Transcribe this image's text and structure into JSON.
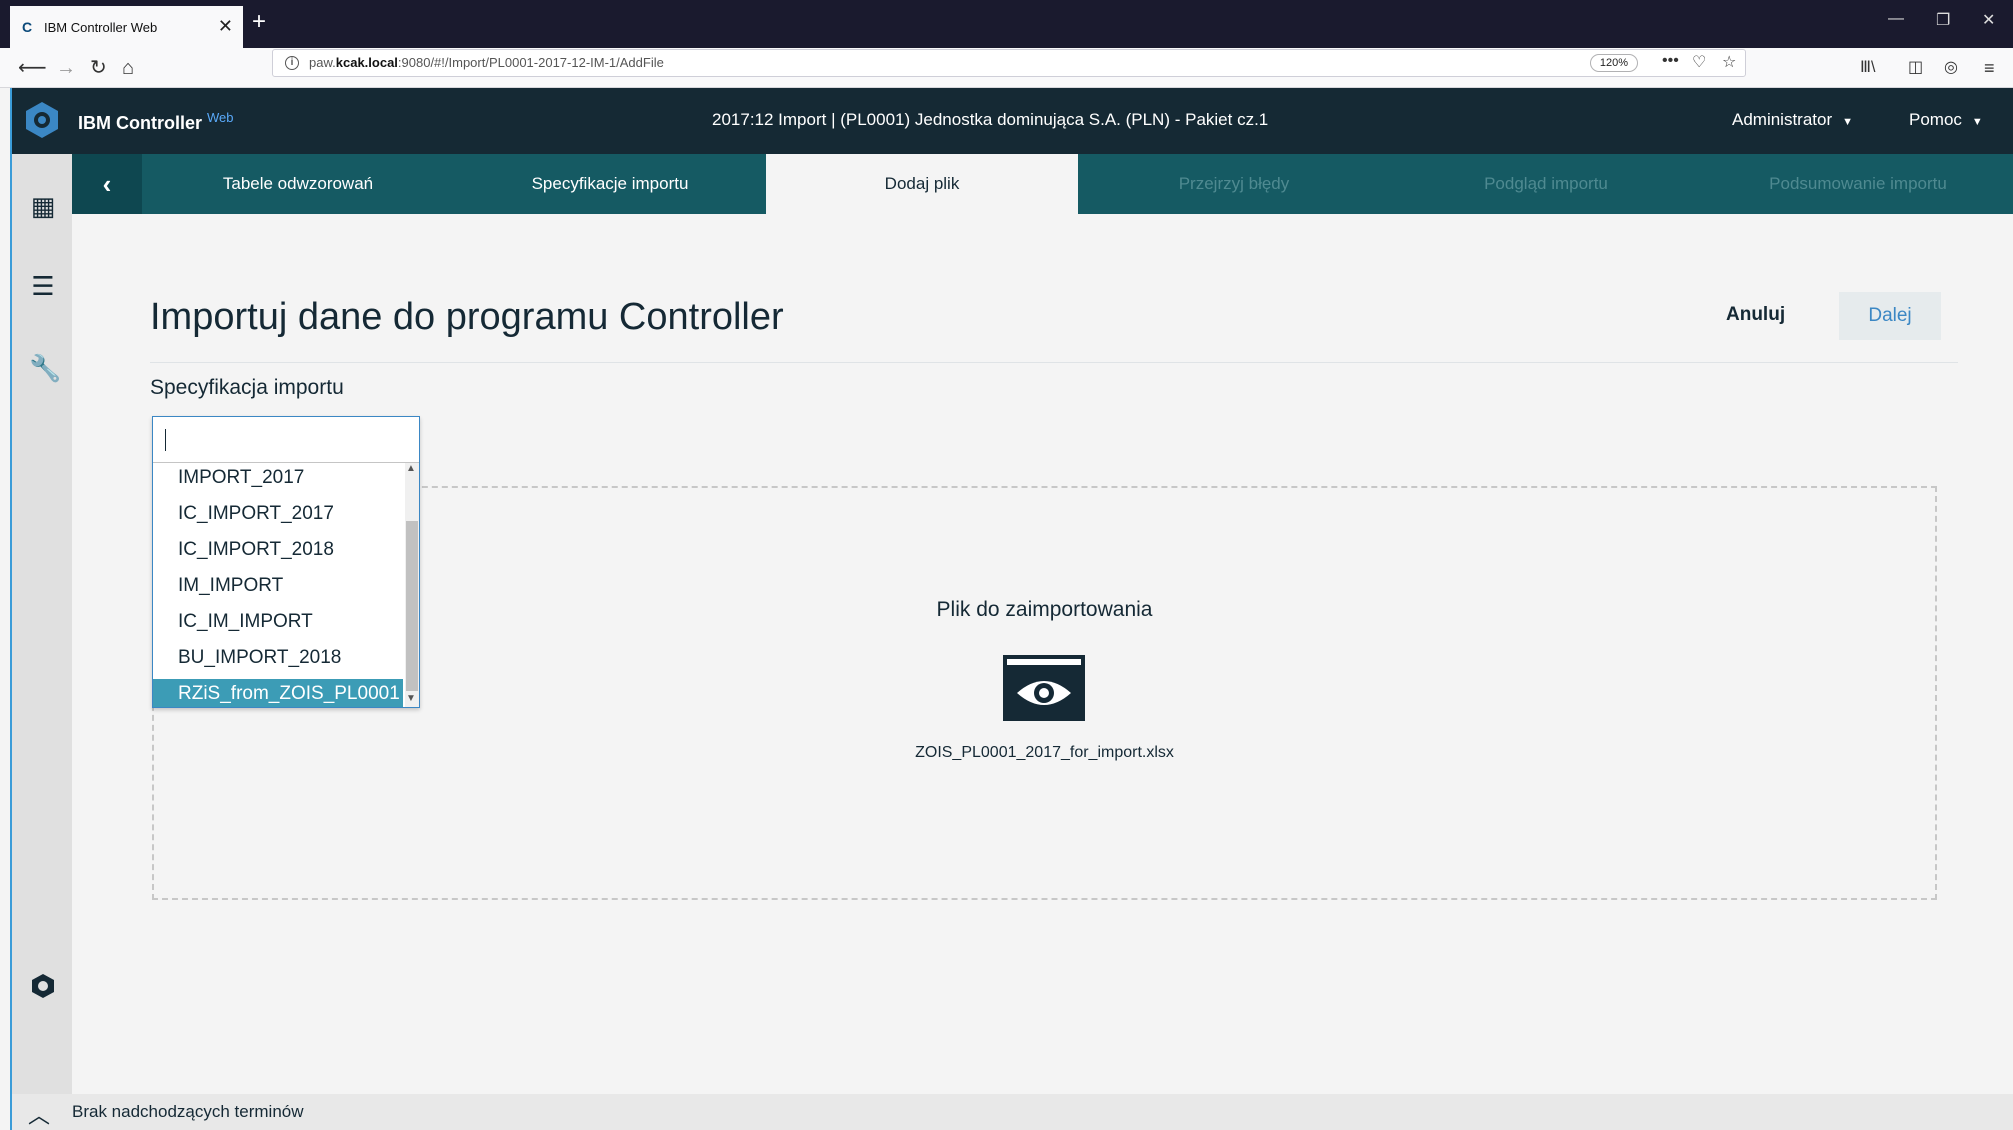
{
  "browser": {
    "tab_title": "IBM Controller Web",
    "url_host_prefix": "paw.",
    "url_host_bold": "kcak.local",
    "url_rest": ":9080/#!/Import/PL0001-2017-12-IM-1/AddFile",
    "zoom": "120%"
  },
  "header": {
    "brand": "IBM Controller",
    "brand_sup": "Web",
    "context": "2017:12 Import  |  (PL0001) Jednostka dominująca S.A. (PLN) - Pakiet cz.1",
    "user": "Administrator",
    "help": "Pomoc"
  },
  "wizard": {
    "steps": [
      {
        "label": "Tabele odwzorowań",
        "state": "done"
      },
      {
        "label": "Specyfikacje importu",
        "state": "done"
      },
      {
        "label": "Dodaj plik",
        "state": "active"
      },
      {
        "label": "Przejrzyj błędy",
        "state": "disabled"
      },
      {
        "label": "Podgląd importu",
        "state": "disabled"
      },
      {
        "label": "Podsumowanie importu",
        "state": "disabled"
      }
    ]
  },
  "page": {
    "title": "Importuj dane do programu Controller",
    "cancel": "Anuluj",
    "next": "Dalej",
    "spec_label": "Specyfikacja importu"
  },
  "dropdown": {
    "input_value": "",
    "options": [
      "IMPORT_2017",
      "IC_IMPORT_2017",
      "IC_IMPORT_2018",
      "IM_IMPORT",
      "IC_IM_IMPORT",
      "BU_IMPORT_2018",
      "RZiS_from_ZOIS_PL0001"
    ],
    "selected_index": 6
  },
  "dropzone": {
    "title": "Plik do zaimportowania",
    "file_name": "ZOIS_PL0001_2017_for_import.xlsx",
    "file_icon": "eye-icon"
  },
  "footer": {
    "text": "Brak nadchodzących terminów"
  },
  "colors": {
    "header_bg": "#152934",
    "wizard_bg": "#155a63",
    "selected_option": "#3c9cb6",
    "accent": "#3b87c4"
  }
}
